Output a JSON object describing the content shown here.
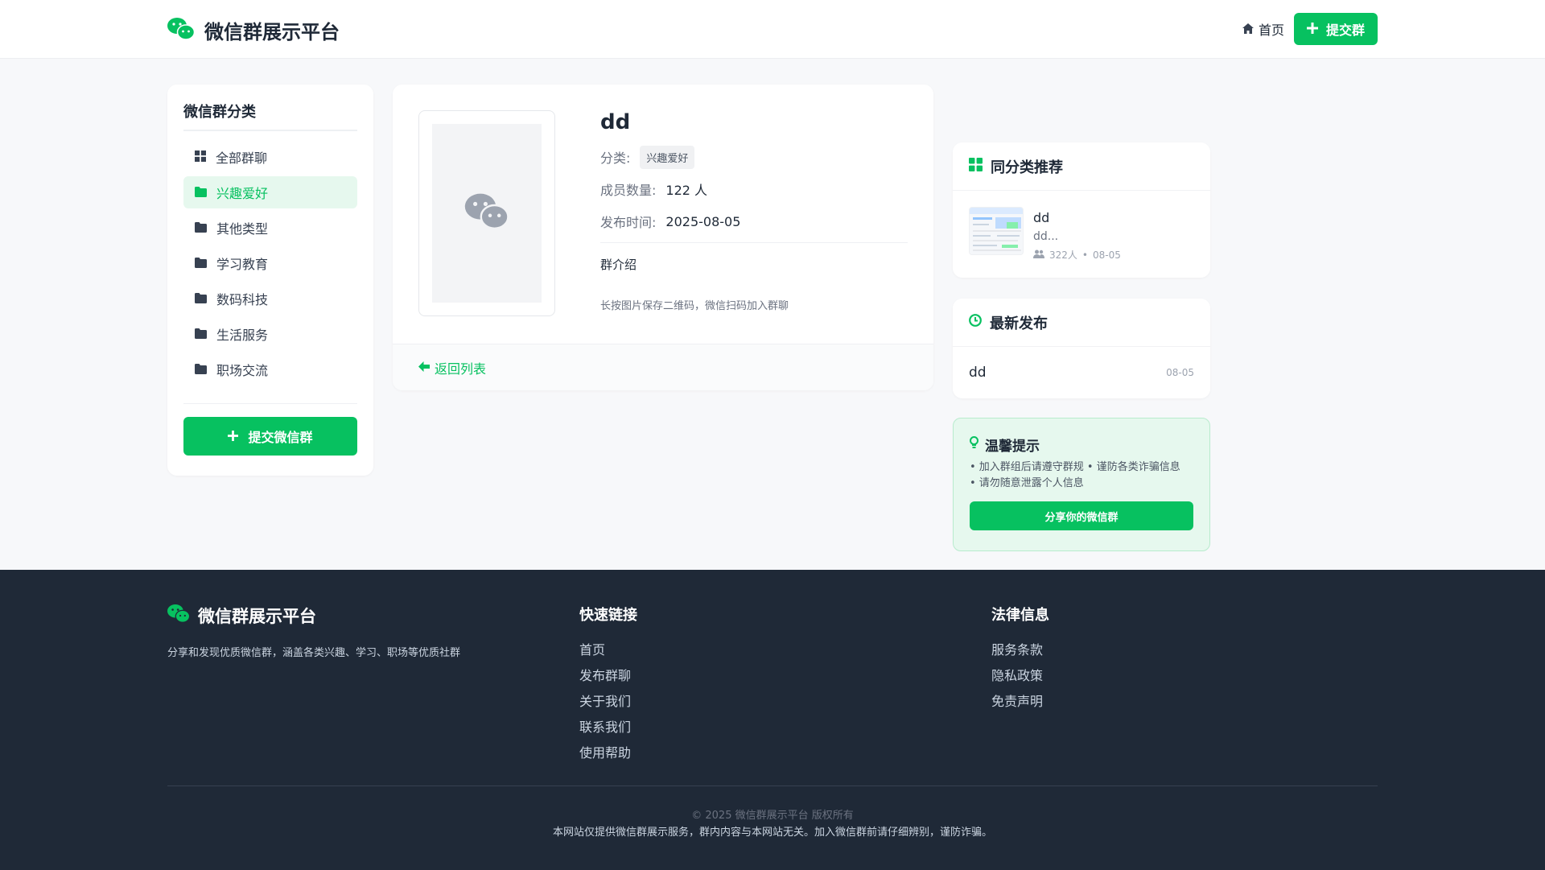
{
  "header": {
    "title": "微信群展示平台",
    "home_label": "首页",
    "submit_label": "提交群",
    "logo_icon": "wechat-icon",
    "brand_color": "#07c160"
  },
  "sidebar": {
    "title": "微信群分类",
    "items": [
      {
        "label": "全部群聊",
        "icon": "grid-icon",
        "active": false
      },
      {
        "label": "兴趣爱好",
        "icon": "folder-icon",
        "active": true
      },
      {
        "label": "其他类型",
        "icon": "folder-icon",
        "active": false
      },
      {
        "label": "学习教育",
        "icon": "folder-icon",
        "active": false
      },
      {
        "label": "数码科技",
        "icon": "folder-icon",
        "active": false
      },
      {
        "label": "生活服务",
        "icon": "folder-icon",
        "active": false
      },
      {
        "label": "职场交流",
        "icon": "folder-icon",
        "active": false
      }
    ],
    "submit_label": "提交微信群"
  },
  "detail": {
    "name": "dd",
    "category_label": "分类:",
    "category_value": "兴趣爱好",
    "members_label": "成员数量:",
    "members_value": "122 人",
    "date_label": "发布时间:",
    "date_value": "2025-08-05",
    "intro_title": "群介绍",
    "hint": "长按图片保存二维码，微信扫码加入群聊",
    "back_label": "返回列表"
  },
  "recommend": {
    "title": "同分类推荐",
    "item": {
      "name": "dd",
      "desc": "dd...",
      "members": "322人",
      "sep": "•",
      "date": "08-05"
    }
  },
  "latest": {
    "title": "最新发布",
    "item": {
      "name": "dd",
      "date": "08-05"
    }
  },
  "tips": {
    "title": "温馨提示",
    "line1": "• 加入群组后请遵守群规 • 谨防各类诈骗信息",
    "line2": "• 请勿随意泄露个人信息",
    "button_label": "分享你的微信群"
  },
  "footer": {
    "brand": "微信群展示平台",
    "description": "分享和发现优质微信群，涵盖各类兴趣、学习、职场等优质社群",
    "quick_title": "快速链接",
    "quick_links": [
      "首页",
      "发布群聊",
      "关于我们",
      "联系我们",
      "使用帮助"
    ],
    "legal_title": "法律信息",
    "legal_links": [
      "服务条款",
      "隐私政策",
      "免责声明"
    ],
    "copyright": "© 2025 微信群展示平台 版权所有",
    "disclaimer": "本网站仅提供微信群展示服务，群内内容与本网站无关。加入微信群前请仔细辨别，谨防诈骗。"
  }
}
